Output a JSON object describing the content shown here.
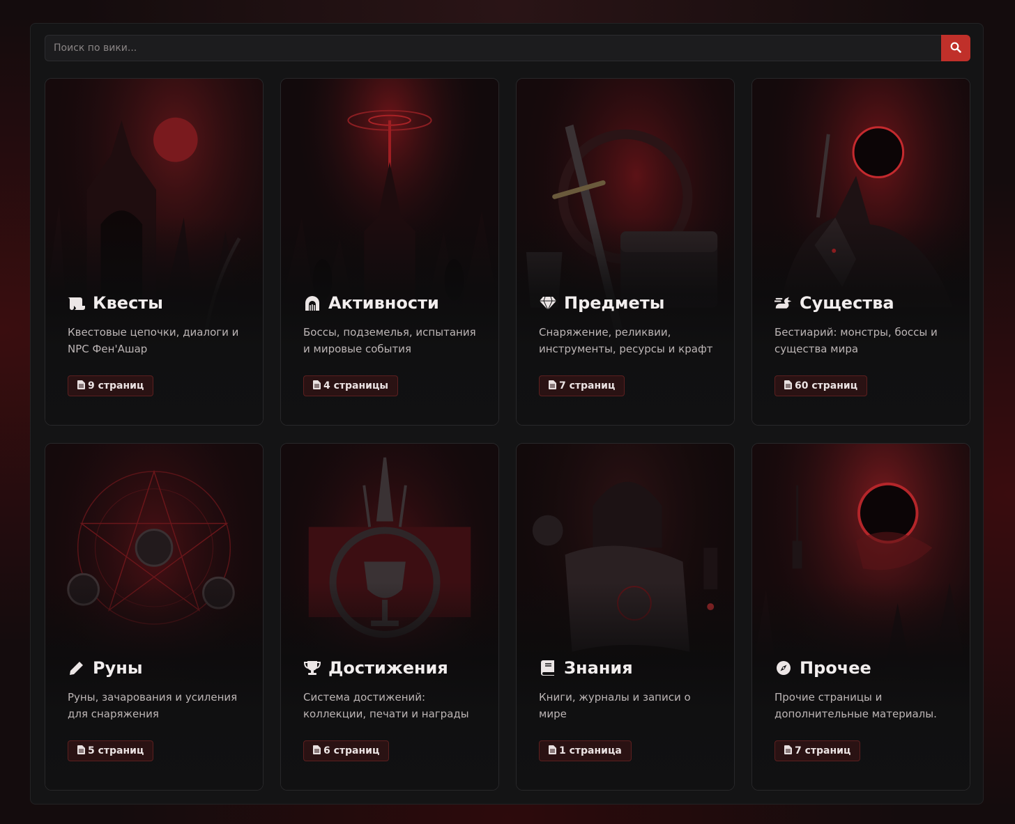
{
  "search": {
    "placeholder": "Поиск по вики...",
    "icon": "search-icon"
  },
  "colors": {
    "accent": "#c0302a",
    "badge_bg": "#2a1213",
    "badge_border": "#5c1f1f"
  },
  "categories": [
    {
      "title": "Квесты",
      "icon": "scroll-icon",
      "desc": "Квестовые цепочки, диалоги и NPC Фен'Ашар",
      "count": "9 страниц"
    },
    {
      "title": "Активности",
      "icon": "dungeon-icon",
      "desc": "Боссы, подземелья, испытания и мировые события",
      "count": "4 страницы"
    },
    {
      "title": "Предметы",
      "icon": "gem-icon",
      "desc": "Снаряжение, реликвии, инструменты, ресурсы и крафт",
      "count": "7 страниц"
    },
    {
      "title": "Существа",
      "icon": "dragon-icon",
      "desc": "Бестиарий: монстры, боссы и существа мира",
      "count": "60 страниц"
    },
    {
      "title": "Руны",
      "icon": "pen-icon",
      "desc": "Руны, зачарования и усиления для снаряжения",
      "count": "5 страниц"
    },
    {
      "title": "Достижения",
      "icon": "trophy-icon",
      "desc": "Система достижений: коллекции, печати и награды",
      "count": "6 страниц"
    },
    {
      "title": "Знания",
      "icon": "book-icon",
      "desc": "Книги, журналы и записи о мире",
      "count": "1 страница"
    },
    {
      "title": "Прочее",
      "icon": "compass-icon",
      "desc": "Прочие страницы и дополнительные материалы.",
      "count": "7 страниц"
    }
  ]
}
